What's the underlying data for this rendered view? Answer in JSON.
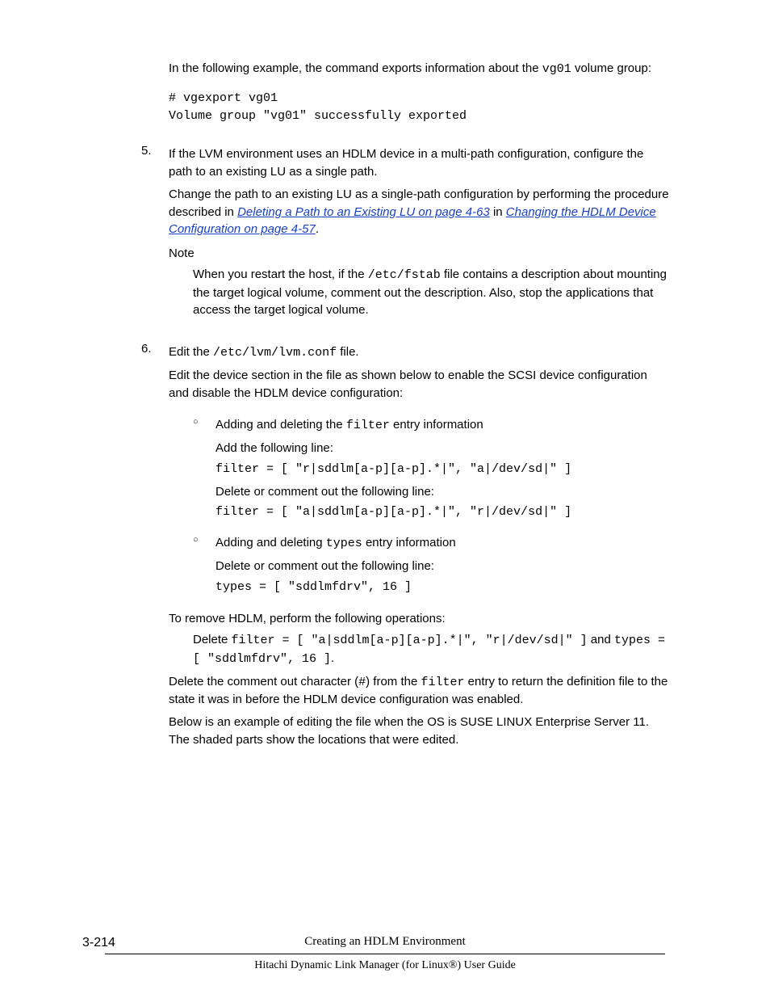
{
  "intro": {
    "p1a": "In the following example, the command exports information about the ",
    "p1b": "vg01",
    "p1c": " volume group:",
    "code": "# vgexport vg01\nVolume group \"vg01\" successfully exported"
  },
  "step5": {
    "num": "5.",
    "p1": "If the LVM environment uses an HDLM device in a multi-path configuration, configure the path to an existing LU as a single path.",
    "p2a": "Change the path to an existing LU as a single-path configuration by performing the procedure described in ",
    "link1": "Deleting a Path to an Existing LU on page 4-63",
    "p2b": " in ",
    "link2": "Changing the HDLM Device Configuration on page 4-57",
    "p2c": ".",
    "note_label": "Note",
    "note_a": "When you restart the host, if the ",
    "note_code": "/etc/fstab",
    "note_b": " file contains a description about mounting the target logical volume, comment out the description. Also, stop the applications that access the target logical volume."
  },
  "step6": {
    "num": "6.",
    "p1a": "Edit the ",
    "p1code": "/etc/lvm/lvm.conf",
    "p1b": " file.",
    "p2": "Edit the device section in the file as shown below to enable the SCSI device configuration and disable the HDLM device configuration:",
    "b1": {
      "l1a": "Adding and deleting the ",
      "l1code": "filter",
      "l1b": " entry information",
      "l2": "Add the following line:",
      "code1": "filter = [ \"r|sddlm[a-p][a-p].*|\", \"a|/dev/sd|\" ]",
      "l3": "Delete or comment out the following line:",
      "code2": "filter = [ \"a|sddlm[a-p][a-p].*|\", \"r|/dev/sd|\" ]"
    },
    "b2": {
      "l1a": "Adding and deleting ",
      "l1code": "types",
      "l1b": " entry information",
      "l2": "Delete or comment out the following line:",
      "code1": "types = [ \"sddlmfdrv\", 16 ]"
    },
    "p3": "To remove HDLM, perform the following operations:",
    "p4a": "Delete ",
    "p4code1": "filter = [ \"a|sddlm[a-p][a-p].*|\", \"r|/dev/sd|\" ]",
    "p4b": " and ",
    "p4code2": "types = [ \"sddlmfdrv\", 16 ]",
    "p4c": ".",
    "p5a": "Delete the comment out character (",
    "p5code1": "#",
    "p5b": ") from the ",
    "p5code2": "filter",
    "p5c": " entry to return the definition file to the state it was in before the HDLM device configuration was enabled.",
    "p6": "Below is an example of editing the file when the OS is SUSE LINUX Enterprise Server 11. The shaded parts show the locations that were edited."
  },
  "footer": {
    "page": "3-214",
    "chapter": "Creating an HDLM Environment",
    "book": "Hitachi Dynamic Link Manager (for Linux®) User Guide"
  }
}
